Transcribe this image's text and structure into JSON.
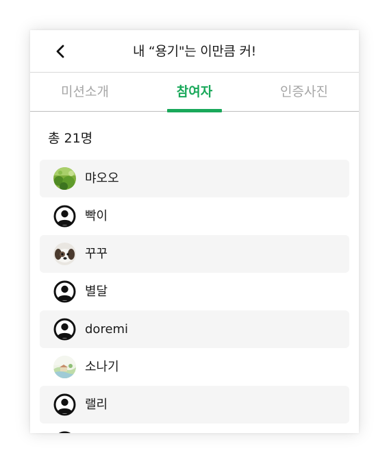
{
  "header": {
    "title": "내 “용기\"는 이만큼 커!",
    "back_icon": "chevron-left-icon"
  },
  "tabs": [
    {
      "label": "미션소개",
      "active": false
    },
    {
      "label": "참여자",
      "active": true
    },
    {
      "label": "인증사진",
      "active": false
    }
  ],
  "participants": {
    "count_label": "총 21명",
    "items": [
      {
        "name": "먀오오",
        "avatar": "grass-photo"
      },
      {
        "name": "빡이",
        "avatar": "default-user-icon"
      },
      {
        "name": "꾸꾸",
        "avatar": "dog-photo"
      },
      {
        "name": "별달",
        "avatar": "default-user-icon"
      },
      {
        "name": "doremi",
        "avatar": "default-user-icon"
      },
      {
        "name": "소나기",
        "avatar": "landscape-photo"
      },
      {
        "name": "랠리",
        "avatar": "default-user-icon"
      },
      {
        "name": "",
        "avatar": "default-user-icon"
      }
    ]
  },
  "colors": {
    "accent": "#19a85a",
    "inactive_tab": "#a6a6a6",
    "row_shade": "#f5f5f5"
  }
}
